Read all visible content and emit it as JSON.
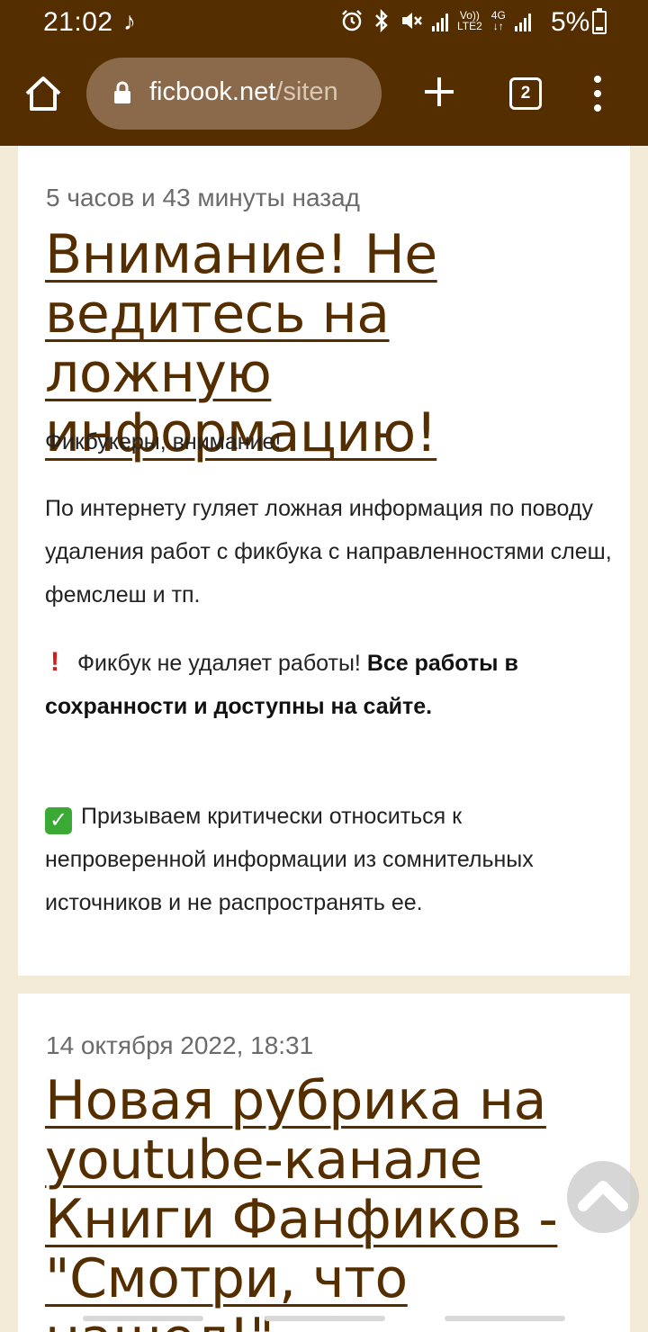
{
  "status_bar": {
    "time": "21:02",
    "battery": "5%",
    "network_label_top": "Vo))",
    "network_label_bottom": "LTE2",
    "network_type": "4G"
  },
  "browser": {
    "url_host": "ficbook.net",
    "url_path": "/siten",
    "tab_count": "2",
    "toolbar_bg": "#552e00"
  },
  "posts": [
    {
      "time": "5 часов и 43 минуты назад",
      "title": "Внимание! Не ведитесь на ложную информацию!",
      "greeting": "Фикбукеры, внимание!",
      "paragraph": "По интернету гуляет ложная информация по поводу удаления работ с фикбука с направленностями слеш, фемслеш и тп.",
      "warning_text": "Фикбук не удаляет работы!",
      "warning_bold": "Все работы в сохранности и доступны на сайте.",
      "check_text": "Призываем критически относиться к непроверенной информации из сомнительных источников и не распространять ее."
    },
    {
      "time": "14 октября 2022, 18:31",
      "title": "Новая рубрика на youtube-канале Книги Фанфиков - \"Смотри, что нашел!\""
    }
  ],
  "colors": {
    "accent": "#552e00",
    "page_bg": "#f3ead8",
    "card_bg": "#ffffff"
  }
}
